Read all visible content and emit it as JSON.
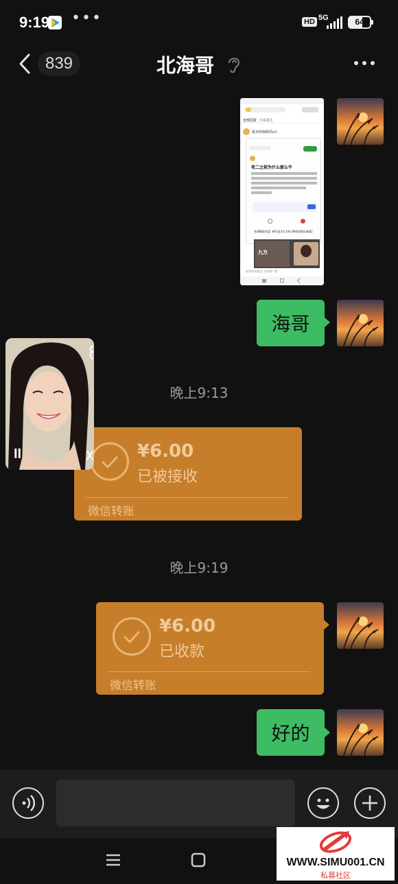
{
  "status_bar": {
    "time": "9:19",
    "more": "•••",
    "hd": "HD",
    "network": "5G",
    "battery": "64"
  },
  "header": {
    "back_count": "839",
    "title": "北海哥"
  },
  "messages": {
    "msg_text_1": "海哥",
    "timestamp_1": "晚上9:13",
    "transfer_1": {
      "amount": "¥6.00",
      "status": "已被接收",
      "label": "微信转账"
    },
    "timestamp_2": "晚上9:19",
    "transfer_2": {
      "amount": "¥6.00",
      "status": "已收款",
      "label": "微信转账"
    },
    "msg_text_2": "好的"
  },
  "screenshot_thumb": {
    "tab1": "全部回复",
    "tab2": "只看楼主",
    "post_title": "老二之前为什么那么牛",
    "post_user": "夏天的雨和风a3",
    "section_title": "本周精彩机会: 新旺这3大主线 (跨境关税出来要)",
    "video_caption": "九方",
    "input_hint": "说说你的看法, 发表第一楼"
  },
  "video_overlay": {
    "pause": "II"
  },
  "watermark": {
    "url": "WWW.SIMU001.CN",
    "name": "私募社区"
  },
  "colors": {
    "green_bubble": "#3ebc63",
    "transfer_bg": "#c67e2a",
    "background": "#111111"
  }
}
